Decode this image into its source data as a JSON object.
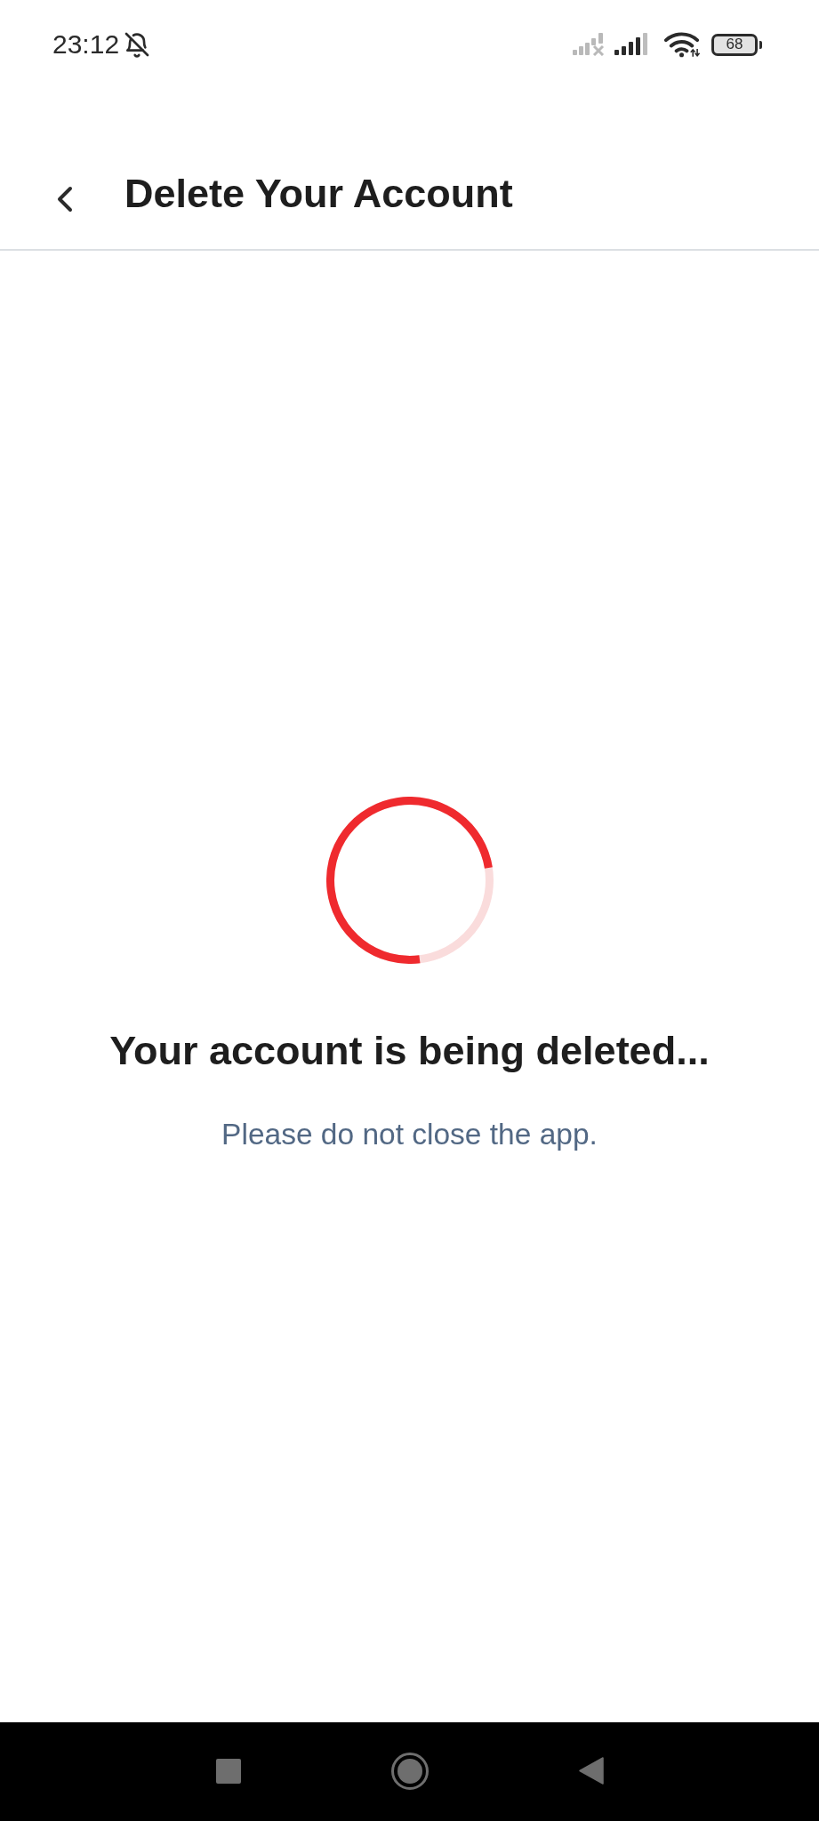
{
  "status_bar": {
    "time": "23:12",
    "battery": "68"
  },
  "header": {
    "title": "Delete Your Account"
  },
  "message": {
    "title": "Your account is being deleted...",
    "subtitle": "Please do not close the app."
  }
}
